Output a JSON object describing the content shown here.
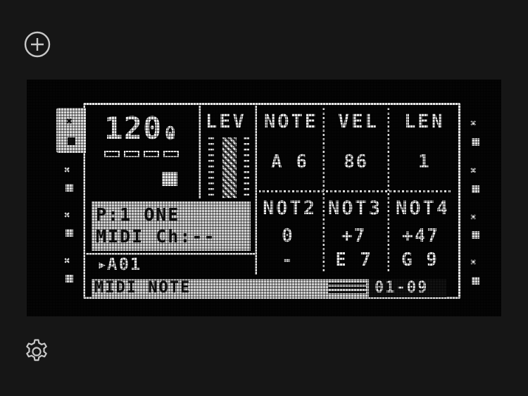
{
  "app": {
    "add_icon": "plus-circle-icon",
    "settings_icon": "gear-icon"
  },
  "screen": {
    "tempo": "120.",
    "tempo_decimal": "0",
    "headers": {
      "lev": "LEV",
      "note": "NOTE",
      "vel": "VEL",
      "len": "LEN",
      "not2": "NOT2",
      "not3": "NOT3",
      "not4": "NOT4"
    },
    "values": {
      "note": "A 6",
      "vel": "86",
      "len": "1",
      "not2_offset": "0",
      "not3_offset": "+7",
      "not4_offset": "+47",
      "not2_note": "-",
      "not3_note": "E 7",
      "not4_note": "G 9"
    },
    "track": {
      "line1": "P:1 ONE",
      "line2": "MIDI Ch:--"
    },
    "pattern": "A01",
    "footer": {
      "label": "MIDI NOTE",
      "range": "01-09"
    },
    "level_percent": 100
  },
  "colors": {
    "background": "#161616",
    "screen": "#050505",
    "pixel": "#e6e6e6"
  }
}
